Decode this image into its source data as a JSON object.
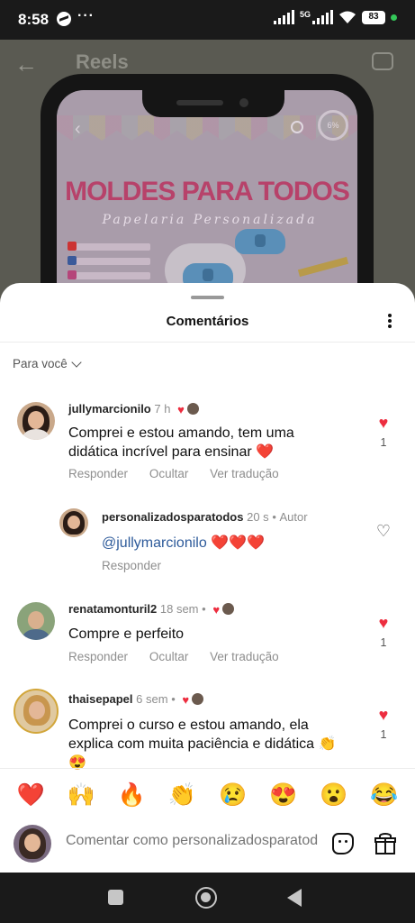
{
  "status_bar": {
    "time": "8:58",
    "network": "5G",
    "battery": "83"
  },
  "reels": {
    "title": "Reels",
    "preview_title": "MOLDES PARA TODOS",
    "preview_subtitle": "Papelaria Personalizada",
    "progress": "6%"
  },
  "sheet": {
    "title": "Comentários",
    "filter_label": "Para você"
  },
  "comments": [
    {
      "username": "jullymarcionilo",
      "time": "7 h",
      "text": "Comprei e estou amando, tem uma didática incrível para ensinar ❤️",
      "actions": [
        "Responder",
        "Ocultar",
        "Ver tradução"
      ],
      "likes": "1",
      "liked": true
    },
    {
      "username": "personalizadosparatodos",
      "time": "20 s",
      "tag": "Autor",
      "mention": "@jullymarcionilo",
      "text": "❤️❤️❤️",
      "actions": [
        "Responder"
      ],
      "likes": ""
    },
    {
      "username": "renatamonturil2",
      "time": "18 sem",
      "text": "Compre  e perfeito",
      "actions": [
        "Responder",
        "Ocultar",
        "Ver tradução"
      ],
      "likes": "1",
      "liked": true
    },
    {
      "username": "thaisepapel",
      "time": "6 sem",
      "text": "Comprei o curso e estou amando, ela explica com muita paciência e didática 👏 😍",
      "likes": "1",
      "liked": true
    }
  ],
  "reactions": [
    "❤️",
    "🙌",
    "🔥",
    "👏",
    "😢",
    "😍",
    "😮",
    "😂"
  ],
  "compose": {
    "placeholder": "Comentar como personalizadosparatodos"
  },
  "icons": {
    "heart_filled": "♥",
    "heart_outline": "♡",
    "accent_color": "#ed2d3f",
    "mention_color": "#2d5a9a"
  }
}
